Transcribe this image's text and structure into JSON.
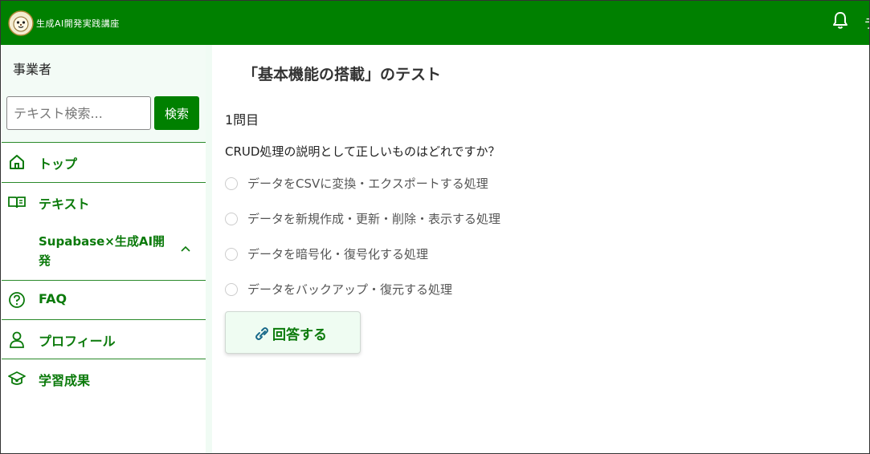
{
  "header": {
    "brand": "生成AI開発実践講座",
    "right_clipped_char": "ラ"
  },
  "sidebar": {
    "user_role": "事業者",
    "search": {
      "placeholder": "テキスト検索...",
      "button_label": "検索"
    },
    "items": [
      {
        "label": "トップ",
        "icon": "home-icon"
      },
      {
        "label": "テキスト",
        "icon": "book-icon"
      },
      {
        "label": "Supabase×生成AI開発",
        "icon": "chevron-up-icon",
        "sub": true
      },
      {
        "label": "FAQ",
        "icon": "question-circle-icon"
      },
      {
        "label": "プロフィール",
        "icon": "user-icon"
      },
      {
        "label": "学習成果",
        "icon": "graduation-cap-icon"
      }
    ]
  },
  "main": {
    "title": "「基本機能の搭載」のテスト",
    "question_number": "1問目",
    "question_text": "CRUD処理の説明として正しいものはどれですか？",
    "options": [
      "データをCSVに変換・エクスポートする処理",
      "データを新規作成・更新・削除・表示する処理",
      "データを暗号化・復号化する処理",
      "データをバックアップ・復元する処理"
    ],
    "answer_button": "回答する"
  },
  "colors": {
    "brand_green": "#008000",
    "nav_text": "#0b7a0b",
    "sidebar_tint": "#f3fbf6"
  }
}
